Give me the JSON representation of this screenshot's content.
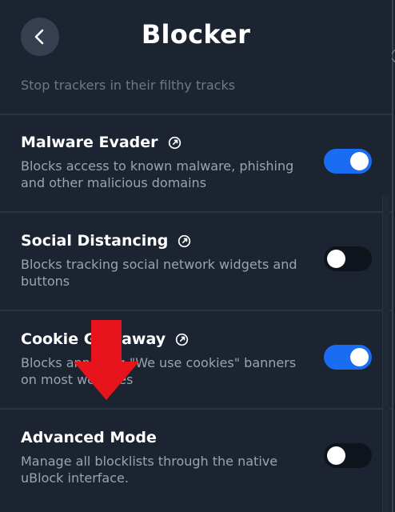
{
  "header": {
    "title": "Blocker",
    "back_icon": "chevron-left-icon"
  },
  "partial_item": {
    "description": "Stop trackers in their filthy tracks"
  },
  "items": [
    {
      "title": "Malware Evader",
      "description": "Blocks access to known malware, phishing and other malicious domains",
      "enabled": true
    },
    {
      "title": "Social Distancing",
      "description": "Blocks tracking social network widgets and buttons",
      "enabled": false
    },
    {
      "title": "Cookie Giveaway",
      "description": "Blocks annoying \"We use cookies\" banners on most websites",
      "enabled": true
    },
    {
      "title": "Advanced Mode",
      "description": "Manage all blocklists through the native uBlock interface.",
      "enabled": false
    }
  ],
  "colors": {
    "background": "#1c2431",
    "toggle_on": "#1a6cf2",
    "toggle_off": "#0f141c",
    "annotation_arrow": "#e8141c"
  },
  "annotation": {
    "type": "down-arrow",
    "color": "#e8141c"
  }
}
